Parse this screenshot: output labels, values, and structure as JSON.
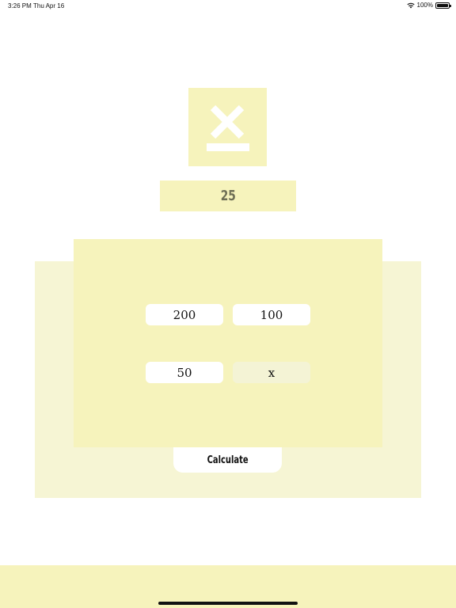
{
  "status_bar": {
    "time": "3:26 PM",
    "date": "Thu Apr 16",
    "battery": "100%"
  },
  "operation_icon": {
    "icon": "multiply-icon"
  },
  "result": {
    "value": "25"
  },
  "inputs": {
    "field1": "200",
    "field2": "100",
    "field3": "50",
    "operator": "x"
  },
  "calculate_button": {
    "label": "Calculate"
  },
  "colors": {
    "accent": "#f6f3bc",
    "panel_back": "#f6f5d4",
    "result_text": "#6e6e55"
  }
}
